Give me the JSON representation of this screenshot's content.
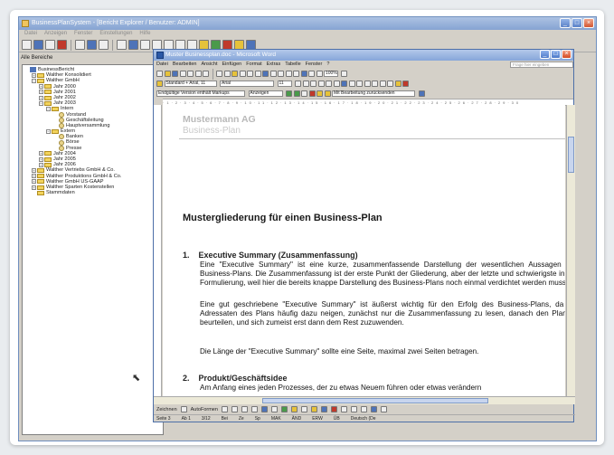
{
  "outer_window": {
    "title": "BusinessPlanSystem - [Bericht Explorer / Benutzer: ADMIN]",
    "menu": [
      "Datei",
      "Anzeigen",
      "Fenster",
      "Einstellungen",
      "Hilfe"
    ]
  },
  "left_pane": {
    "header": "Alle Bereiche",
    "tree": [
      {
        "label": "BusinessBericht",
        "level": 0,
        "icon": "root-icon",
        "expander": ""
      },
      {
        "label": "Walther Konsolidiert",
        "level": 1,
        "icon": "folder-icon",
        "expander": "+"
      },
      {
        "label": "Walther GmbH",
        "level": 1,
        "icon": "folder-icon",
        "expander": "-"
      },
      {
        "label": "Jahr 2000",
        "level": 2,
        "icon": "folder-icon",
        "expander": "+"
      },
      {
        "label": "Jahr 2001",
        "level": 2,
        "icon": "folder-icon",
        "expander": "+"
      },
      {
        "label": "Jahr 2002",
        "level": 2,
        "icon": "folder-icon",
        "expander": "+"
      },
      {
        "label": "Jahr 2003",
        "level": 2,
        "icon": "folder-icon",
        "expander": "-"
      },
      {
        "label": "Intern",
        "level": 3,
        "icon": "folder-icon",
        "expander": "-"
      },
      {
        "label": "Vorstand",
        "level": 4,
        "icon": "item-icon",
        "expander": ""
      },
      {
        "label": "Geschäftsleitung",
        "level": 4,
        "icon": "item-icon",
        "expander": ""
      },
      {
        "label": "Hauptversammlung",
        "level": 4,
        "icon": "item-icon",
        "expander": ""
      },
      {
        "label": "Extern",
        "level": 3,
        "icon": "folder-icon",
        "expander": "-"
      },
      {
        "label": "Banken",
        "level": 4,
        "icon": "item-icon",
        "expander": ""
      },
      {
        "label": "Börse",
        "level": 4,
        "icon": "item-icon",
        "expander": ""
      },
      {
        "label": "Presse",
        "level": 4,
        "icon": "item-icon",
        "expander": ""
      },
      {
        "label": "Jahr 2004",
        "level": 2,
        "icon": "folder-icon",
        "expander": "+"
      },
      {
        "label": "Jahr 2005",
        "level": 2,
        "icon": "folder-icon",
        "expander": "+"
      },
      {
        "label": "Jahr 2006",
        "level": 2,
        "icon": "folder-icon",
        "expander": "+"
      },
      {
        "label": "Walther Vertriebs GmbH & Co.",
        "level": 1,
        "icon": "folder-icon",
        "expander": "+"
      },
      {
        "label": "Walther Produktions GmbH & Co.",
        "level": 1,
        "icon": "folder-icon",
        "expander": "+"
      },
      {
        "label": "Walther GmbH US-GAAP",
        "level": 1,
        "icon": "folder-icon",
        "expander": "+"
      },
      {
        "label": "Walther Sparten Kostenstellen",
        "level": 1,
        "icon": "folder-icon",
        "expander": "+"
      },
      {
        "label": "Stammdaten",
        "level": 1,
        "icon": "folder-icon",
        "expander": ""
      }
    ]
  },
  "word": {
    "title": "Muster Businessplan.doc - Microsoft Word",
    "menu": [
      "Datei",
      "Bearbeiten",
      "Ansicht",
      "Einfügen",
      "Format",
      "Extras",
      "Tabelle",
      "Fenster",
      "?"
    ],
    "help_placeholder": "Frage hier eingeben",
    "style_box": "Standard + Arial, 11",
    "font_box": "Arial",
    "size_box": "11",
    "zoom_box": "100%",
    "track_box": "Endgültige Version enthält Markups",
    "show_label": "Anzeigen",
    "reply_label": "Mit Bearbeitung zurücksenden",
    "page": {
      "company": "Mustermann AG",
      "subtitle": "Business-Plan",
      "heading": "Mustergliederung für einen Business-Plan",
      "sections": [
        {
          "number": "1.",
          "title": "Executive Summary (Zusammenfassung)"
        },
        {
          "number": "2.",
          "title": "Produkt/Geschäftsidee"
        }
      ],
      "paragraphs": [
        "Eine \"Executive Summary\" ist eine kurze, zusammenfassende Darstellung der wesentlichen Aussagen des Business-Plans. Die Zusammenfassung ist der erste Punkt der Gliederung, aber der letzte und schwierigste in der Formulierung, weil hier die bereits knappe Darstellung des Business-Plans noch einmal verdichtet werden muss.",
        "Eine gut geschriebene \"Executive Summary\" ist äußerst wichtig für den Erfolg des Business-Plans, da die Adressaten des Plans häufig dazu neigen, zunächst nur die Zusammenfassung zu lesen, danach den Plan zu beurteilen, und sich zumeist erst dann dem Rest zuzuwenden.",
        "Die Länge der \"Executive Summary\" sollte eine Seite, maximal zwei Seiten betragen.",
        "Am Anfang eines jeden Prozesses, der zu etwas Neuem führen oder etwas verändern"
      ]
    },
    "draw_label": "Zeichnen",
    "autoshapes_label": "AutoFormen",
    "status": [
      "Seite 3",
      "Ab 1",
      "3/12",
      "Bei",
      "Ze",
      "Sp",
      "MAK",
      "ÄND",
      "ERW",
      "ÜB",
      "Deutsch (De"
    ]
  }
}
